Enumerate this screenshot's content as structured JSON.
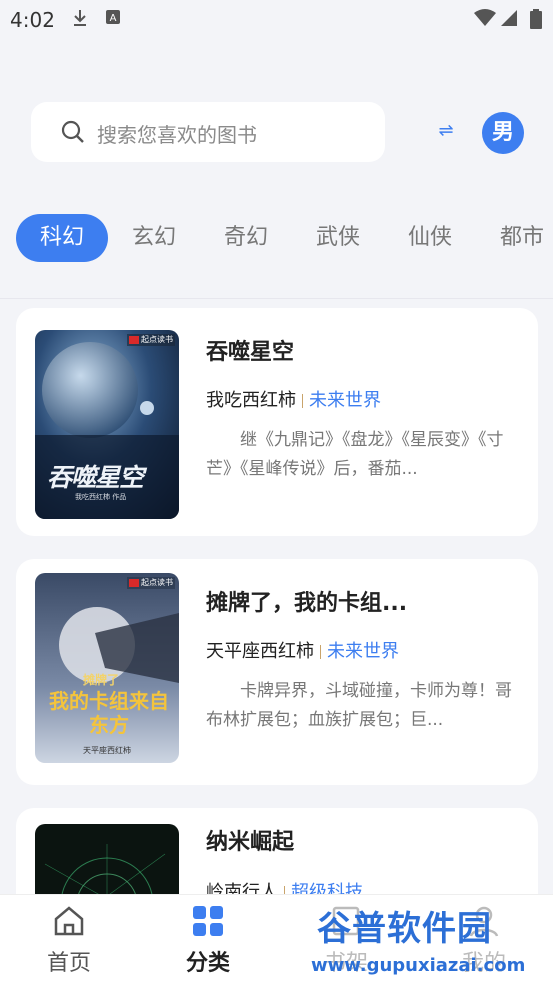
{
  "status": {
    "time": "4:02",
    "icons": [
      "download-icon",
      "storage-icon",
      "wifi-icon",
      "signal-icon",
      "battery-icon"
    ]
  },
  "search": {
    "placeholder": "搜索您喜欢的图书"
  },
  "gender": {
    "label": "男"
  },
  "tabs": [
    {
      "label": "科幻",
      "active": true
    },
    {
      "label": "玄幻",
      "active": false
    },
    {
      "label": "奇幻",
      "active": false
    },
    {
      "label": "武侠",
      "active": false
    },
    {
      "label": "仙侠",
      "active": false
    },
    {
      "label": "都市",
      "active": false
    }
  ],
  "books": [
    {
      "title": "吞噬星空",
      "author": "我吃西红柿",
      "genre": "未来世界",
      "desc": "继《九鼎记》《盘龙》《星辰变》《寸芒》《星峰传说》后，番茄...",
      "cover_text": "吞噬星空",
      "cover_brand": "起点读书",
      "cover_sub": "我吃西红柿 作品"
    },
    {
      "title": "摊牌了，我的卡组...",
      "author": "天平座西红柿",
      "genre": "未来世界",
      "desc": "卡牌异界，斗域碰撞，卡师为尊！哥布林扩展包；血族扩展包；巨...",
      "cover_text": "我的卡组来自东方",
      "cover_sub_top": "摊牌了",
      "cover_brand": "起点读书",
      "cover_sub": "天平座西红柿"
    },
    {
      "title": "纳米崛起",
      "author": "岭南行人",
      "genre": "超级科技",
      "desc": ""
    }
  ],
  "nav": [
    {
      "label": "首页",
      "active": false
    },
    {
      "label": "分类",
      "active": true
    },
    {
      "label": "书架",
      "active": false
    },
    {
      "label": "我的",
      "active": false
    }
  ],
  "watermark": {
    "title": "谷普软件园",
    "url": "www.gupuxiazai.com"
  }
}
